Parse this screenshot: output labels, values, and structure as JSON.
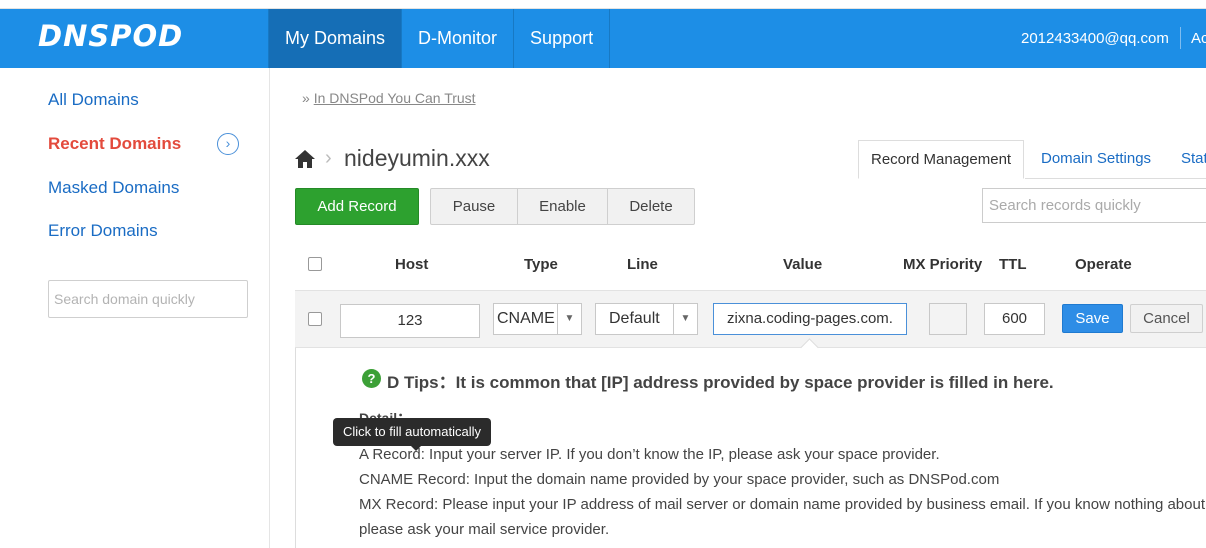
{
  "header": {
    "logo": "DNSPOD",
    "nav": [
      "My Domains",
      "D-Monitor",
      "Support"
    ],
    "user_email": "2012433400@qq.com",
    "user_more": "Ac"
  },
  "sidebar": {
    "items": [
      "All Domains",
      "Recent Domains",
      "Masked Domains",
      "Error Domains"
    ],
    "search_placeholder": "Search domain quickly"
  },
  "breadcrumb": {
    "prefix": "»",
    "link": "In DNSPod You Can Trust"
  },
  "domain": {
    "name": "nideyumin.xxx"
  },
  "tabs": [
    "Record Management",
    "Domain Settings",
    "Stat"
  ],
  "toolbar": {
    "add": "Add Record",
    "pause": "Pause",
    "enable": "Enable",
    "delete": "Delete",
    "search_placeholder": "Search records quickly"
  },
  "columns": [
    "Host",
    "Type",
    "Line",
    "Value",
    "MX Priority",
    "TTL",
    "Operate"
  ],
  "edit_row": {
    "host": "123",
    "type": "CNAME",
    "line": "Default",
    "value": "zixna.coding-pages.com.",
    "mx": "",
    "ttl": "600",
    "save": "Save",
    "cancel": "Cancel"
  },
  "tip": {
    "title": "D Tips：It is common that [IP] address provided by space provider is filled in here.",
    "detail": "Detail：",
    "lines": [
      "A Record: Input your server IP. If you don’t know the IP, please ask your space provider.",
      "CNAME Record: Input the domain name provided by your space provider, such as DNSPod.com",
      "MX Record: Please input your IP address of mail server or domain name provided by business email. If you know nothing about",
      "please ask your mail service provider."
    ]
  },
  "tooltip": "Click to fill automatically",
  "colors": {
    "header": "#1d8ee6",
    "add": "#2da12f",
    "save": "#2e8de6",
    "current": "#e34a3c"
  },
  "icons": [
    "home-icon",
    "chevron-right-icon",
    "circle-arrow-icon",
    "question-icon",
    "dropdown-arrow-icon"
  ]
}
